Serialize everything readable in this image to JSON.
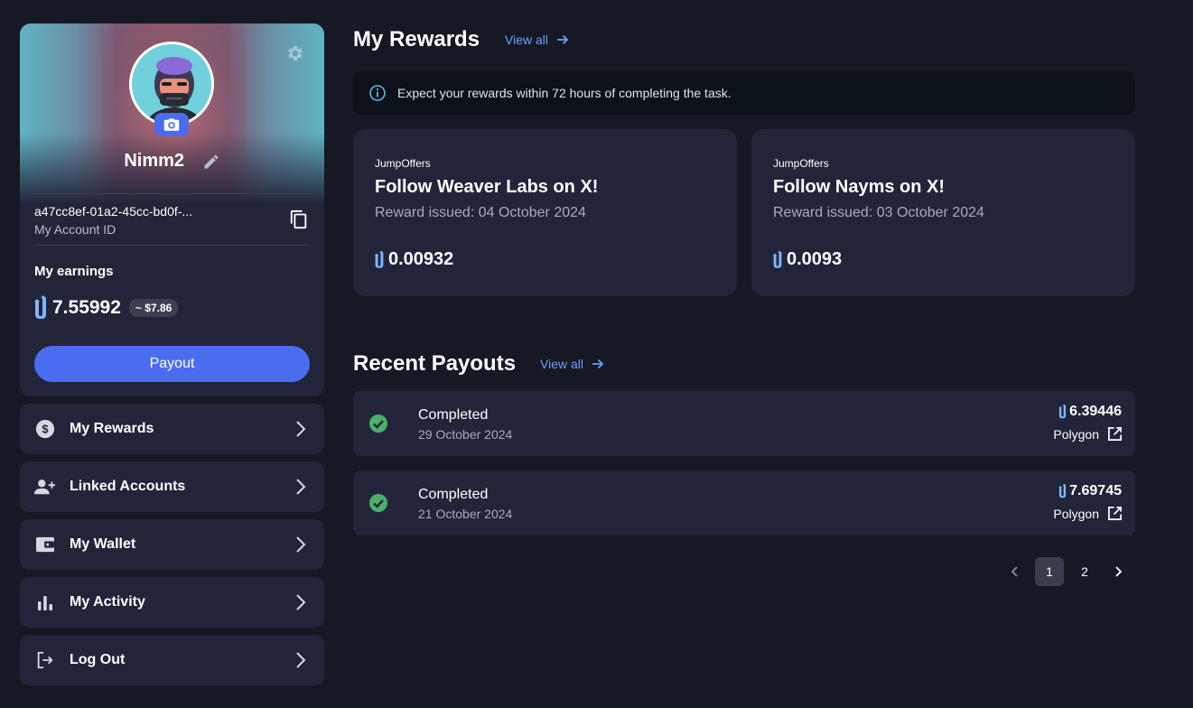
{
  "profile": {
    "username": "Nimm2",
    "account_id": "a47cc8ef-01a2-45cc-bd0f-...",
    "account_id_label": "My Account ID",
    "earnings_label": "My earnings",
    "earnings_value": "7.55992",
    "earnings_usd": "~ $7.86",
    "payout_label": "Payout"
  },
  "menu": [
    {
      "label": "My Rewards",
      "icon": "dollar-circle-icon"
    },
    {
      "label": "Linked Accounts",
      "icon": "add-user-icon"
    },
    {
      "label": "My Wallet",
      "icon": "wallet-icon"
    },
    {
      "label": "My Activity",
      "icon": "bar-chart-icon"
    },
    {
      "label": "Log Out",
      "icon": "logout-icon"
    }
  ],
  "rewards": {
    "title": "My Rewards",
    "view_all": "View all",
    "info": "Expect your rewards within 72 hours of completing the task.",
    "cards": [
      {
        "provider": "JumpOffers",
        "title": "Follow Weaver Labs on X!",
        "date": "Reward issued: 04 October 2024",
        "amount": "0.00932"
      },
      {
        "provider": "JumpOffers",
        "title": "Follow Nayms on X!",
        "date": "Reward issued: 03 October 2024",
        "amount": "0.0093"
      }
    ]
  },
  "payouts": {
    "title": "Recent Payouts",
    "view_all": "View all",
    "items": [
      {
        "status": "Completed",
        "date": "29 October 2024",
        "amount": "6.39446",
        "network": "Polygon"
      },
      {
        "status": "Completed",
        "date": "21 October 2024",
        "amount": "7.69745",
        "network": "Polygon"
      }
    ]
  },
  "pagination": {
    "prev": "‹",
    "pages": [
      "1",
      "2"
    ],
    "current": "1",
    "next": "›"
  },
  "colors": {
    "background": "#161823",
    "card": "#22253a",
    "accent": "#4a6df0",
    "link": "#6aa1ff",
    "success": "#4caf6a",
    "token": "#7fb6ff"
  }
}
